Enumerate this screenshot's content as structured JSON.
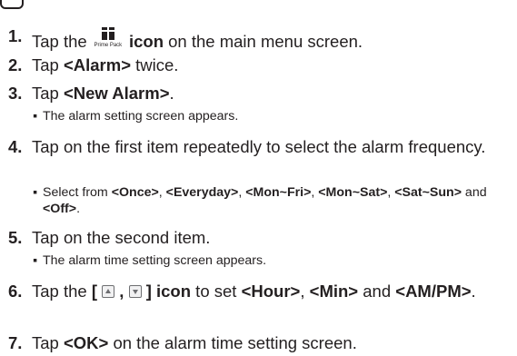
{
  "steps": [
    {
      "num": "1.",
      "text": [
        "Tap the ",
        " ",
        "icon",
        " on the main menu screen."
      ],
      "icon_caption": "Prime Pack",
      "icon_name": "prime-pack-icon"
    },
    {
      "num": "2.",
      "text": [
        "Tap ",
        "<Alarm>",
        " twice."
      ]
    },
    {
      "num": "3.",
      "text": [
        "Tap ",
        "<New Alarm>",
        "."
      ]
    },
    {
      "num": "4.",
      "text": [
        "Tap on the first item repeatedly to select the alarm frequency."
      ]
    },
    {
      "num": "5.",
      "text": [
        "Tap on the second item."
      ]
    },
    {
      "num": "6.",
      "text": [
        "Tap the ",
        "[",
        " , ",
        "] icon",
        " to set ",
        "<Hour>",
        ", ",
        "<Min>",
        " and ",
        "<AM/PM>",
        "."
      ]
    },
    {
      "num": "7.",
      "text": [
        "Tap ",
        "<OK>",
        " on the alarm time setting screen."
      ]
    }
  ],
  "substeps": {
    "s3": "The alarm setting screen appears.",
    "s4": [
      "Select from ",
      "<Once>",
      ", ",
      "<Everyday>",
      ", ",
      "<Mon~Fri>",
      ", ",
      "<Mon~Sat>",
      ", ",
      "<Sat~Sun>",
      " and ",
      "<Off>",
      "."
    ],
    "s5": "The alarm time setting screen appears."
  },
  "bullet": "▪",
  "icons": {
    "up": "up-arrow-button-icon",
    "down": "down-arrow-button-icon"
  }
}
